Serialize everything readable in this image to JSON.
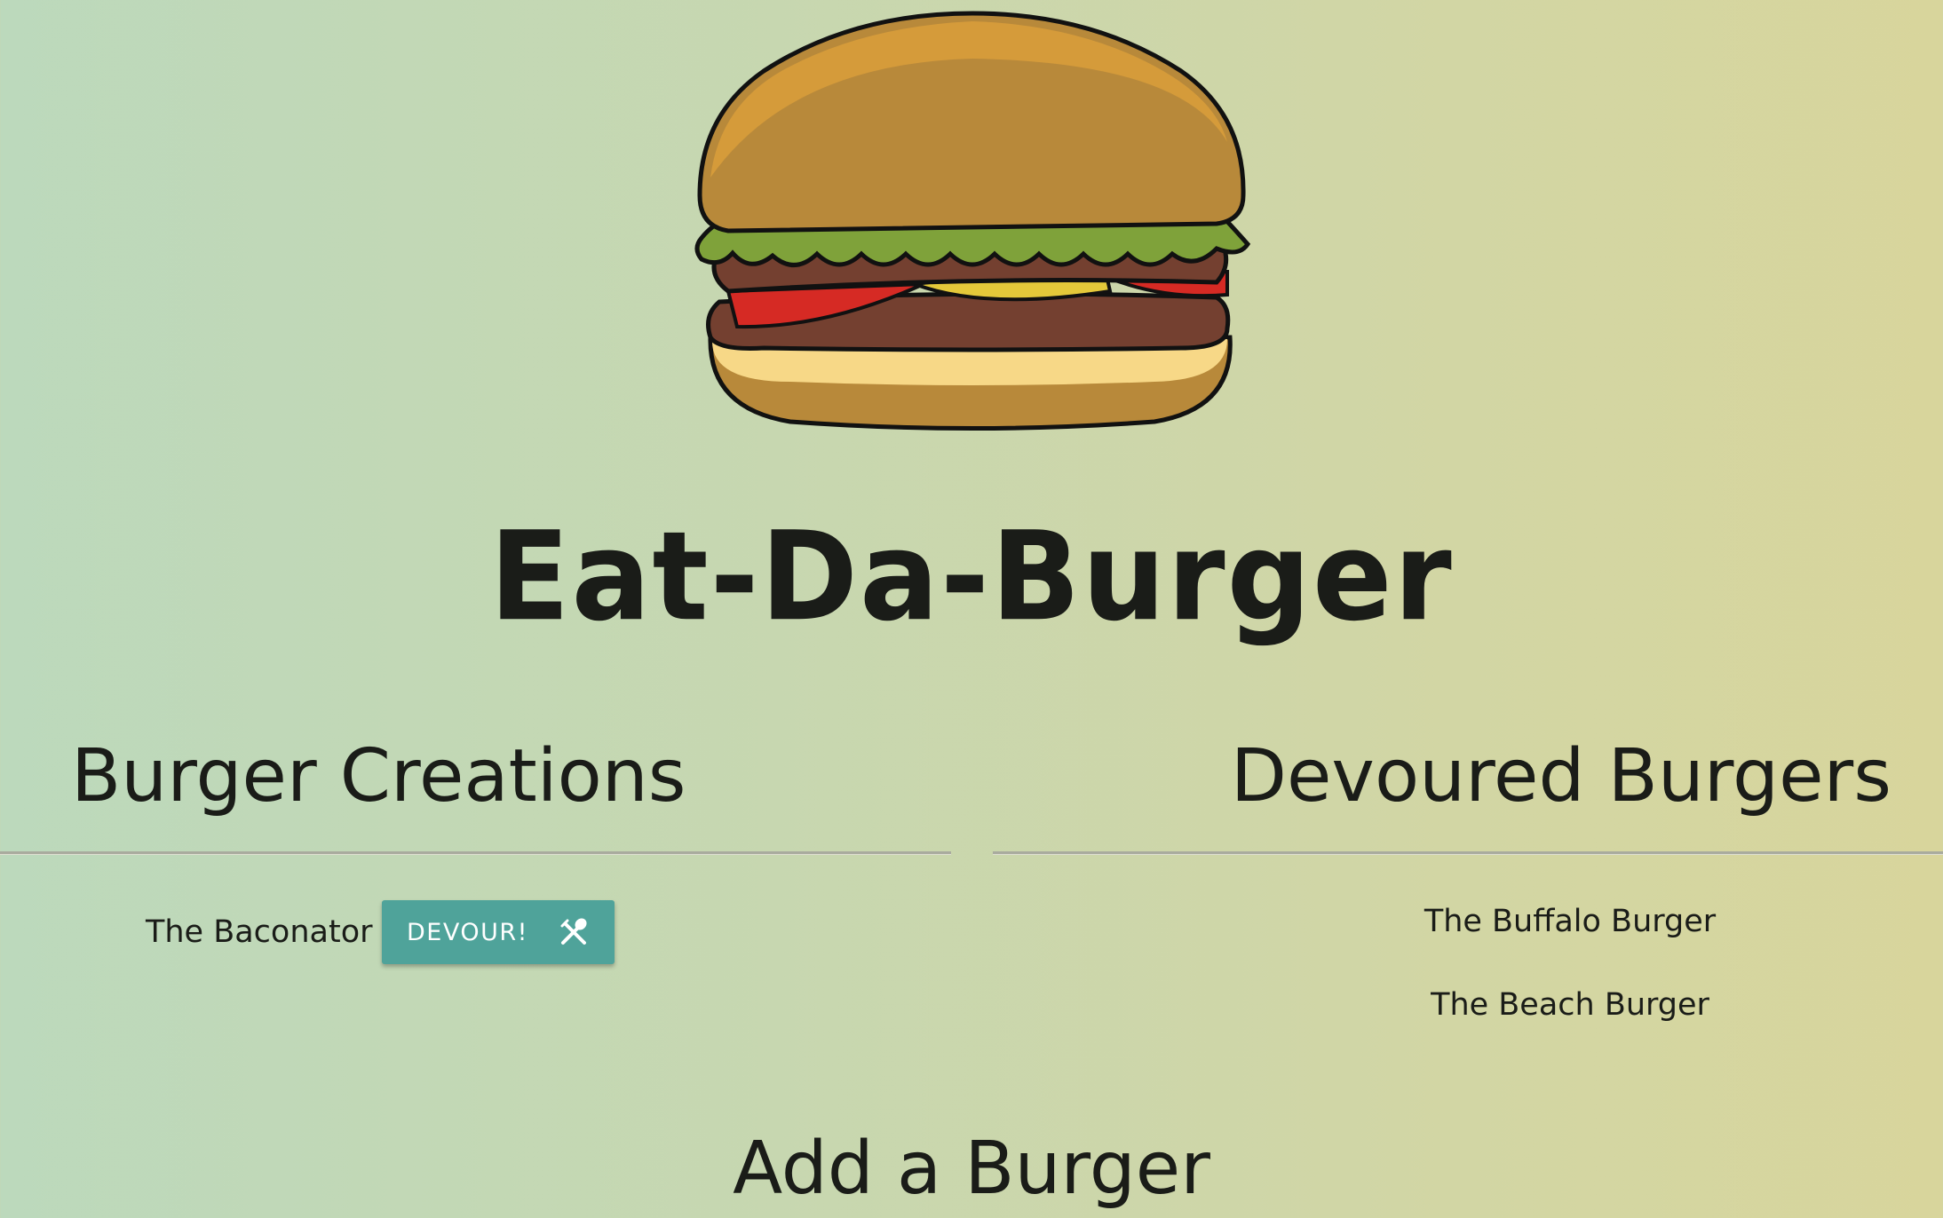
{
  "header": {
    "logo_icon": "hamburger-illustration",
    "title": "Eat-Da-Burger"
  },
  "creations": {
    "heading": "Burger Creations",
    "items": [
      {
        "name": "The Baconator",
        "button_label": "DEVOUR!",
        "button_icon": "fork-and-knife-icon"
      }
    ]
  },
  "devoured": {
    "heading": "Devoured Burgers",
    "items": [
      {
        "name": "The Buffalo Burger"
      },
      {
        "name": "The Beach Burger"
      }
    ]
  },
  "add_form": {
    "heading": "Add a Burger"
  },
  "colors": {
    "button_bg": "#4fa39a",
    "text": "#1a1c18",
    "bg_left": "#bcd9bc",
    "bg_right": "#d8d59c"
  }
}
